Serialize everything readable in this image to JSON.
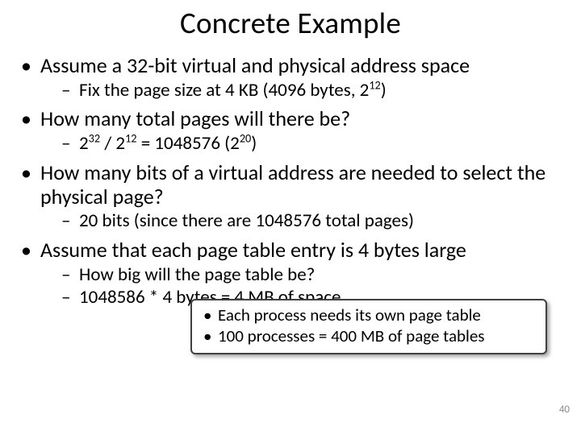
{
  "title": "Concrete Example",
  "bullets": {
    "b1": "Assume a 32-bit virtual and physical address space",
    "b1s1_a": "Fix the page size at 4 KB (4096 bytes, 2",
    "b1s1_sup": "12",
    "b1s1_b": ")",
    "b2": "How many total pages will there be?",
    "b2s1_a": "2",
    "b2s1_sup1": "32",
    "b2s1_b": " / 2",
    "b2s1_sup2": "12",
    "b2s1_c": " = 1048576 (2",
    "b2s1_sup3": "20",
    "b2s1_d": ")",
    "b3": "How many bits of a virtual address are needed to select the physical page?",
    "b3s1": " 20 bits (since there are 1048576 total pages)",
    "b4": "Assume that each page table entry is 4 bytes large",
    "b4s1": "How big will the page table be?",
    "b4s2": "1048586 * 4 bytes = 4 MB of space"
  },
  "callout": {
    "l1": "Each process needs its own page table",
    "l2": "100 processes = 400 MB of page tables"
  },
  "pagenum": "40"
}
